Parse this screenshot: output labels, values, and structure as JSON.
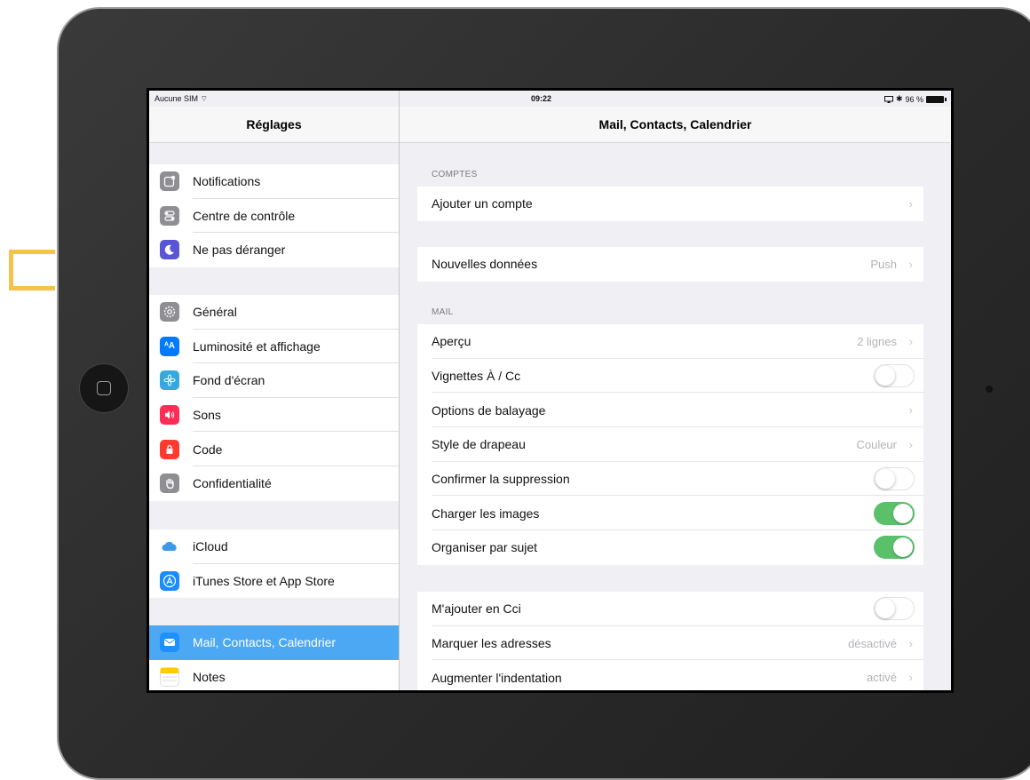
{
  "status_bar": {
    "carrier": "Aucune SIM ⌔",
    "time": "09:22",
    "battery": "96 %"
  },
  "sidebar": {
    "title": "Réglages",
    "groups": [
      {
        "items": [
          {
            "label": "Notifications",
            "icon": "notifications-icon",
            "color": "#8e8e93"
          },
          {
            "label": "Centre de contrôle",
            "icon": "control-center-icon",
            "color": "#8e8e93"
          },
          {
            "label": "Ne pas déranger",
            "icon": "moon-icon",
            "color": "#5856d6"
          }
        ]
      },
      {
        "items": [
          {
            "label": "Général",
            "icon": "gear-icon",
            "color": "#8e8e93"
          },
          {
            "label": "Luminosité et affichage",
            "icon": "brightness-icon",
            "color": "#007aff"
          },
          {
            "label": "Fond d'écran",
            "icon": "wallpaper-icon",
            "color": "#34aadc"
          },
          {
            "label": "Sons",
            "icon": "sound-icon",
            "color": "#ff2d55"
          },
          {
            "label": "Code",
            "icon": "lock-icon",
            "color": "#ff3b30"
          },
          {
            "label": "Confidentialité",
            "icon": "hand-icon",
            "color": "#8e8e93"
          }
        ]
      },
      {
        "items": [
          {
            "label": "iCloud",
            "icon": "cloud-icon",
            "color": "#ffffff"
          },
          {
            "label": "iTunes Store et App Store",
            "icon": "app-store-icon",
            "color": "#1a8cff"
          }
        ]
      },
      {
        "items": [
          {
            "label": "Mail, Contacts, Calendrier",
            "icon": "mail-icon",
            "color": "#1e90ff",
            "selected": true
          },
          {
            "label": "Notes",
            "icon": "notes-icon",
            "color": "#ffffff"
          }
        ]
      }
    ]
  },
  "main": {
    "title": "Mail, Contacts, Calendrier",
    "sections": [
      {
        "header": "COMPTES",
        "rows": [
          {
            "label": "Ajouter un compte",
            "value": "",
            "chevron": true
          }
        ]
      },
      {
        "header": "",
        "rows": [
          {
            "label": "Nouvelles données",
            "value": "Push",
            "chevron": true
          }
        ]
      },
      {
        "header": "MAIL",
        "rows": [
          {
            "label": "Aperçu",
            "value": "2 lignes",
            "chevron": true
          },
          {
            "label": "Vignettes À / Cc",
            "toggle": false
          },
          {
            "label": "Options de balayage",
            "value": "",
            "chevron": true
          },
          {
            "label": "Style de drapeau",
            "value": "Couleur",
            "chevron": true
          },
          {
            "label": "Confirmer la suppression",
            "toggle": false
          },
          {
            "label": "Charger les images",
            "toggle": true
          },
          {
            "label": "Organiser par sujet",
            "toggle": true
          }
        ]
      },
      {
        "header": "",
        "rows": [
          {
            "label": "M'ajouter en Cci",
            "toggle": false
          },
          {
            "label": "Marquer les adresses",
            "value": "désactivé",
            "chevron": true
          },
          {
            "label": "Augmenter l'indentation",
            "value": "activé",
            "chevron": true
          }
        ]
      }
    ]
  },
  "colors": {
    "accent": "#4ca8f2",
    "toggle_on": "#5ac06a",
    "highlight_marker": "#f3c44c"
  }
}
